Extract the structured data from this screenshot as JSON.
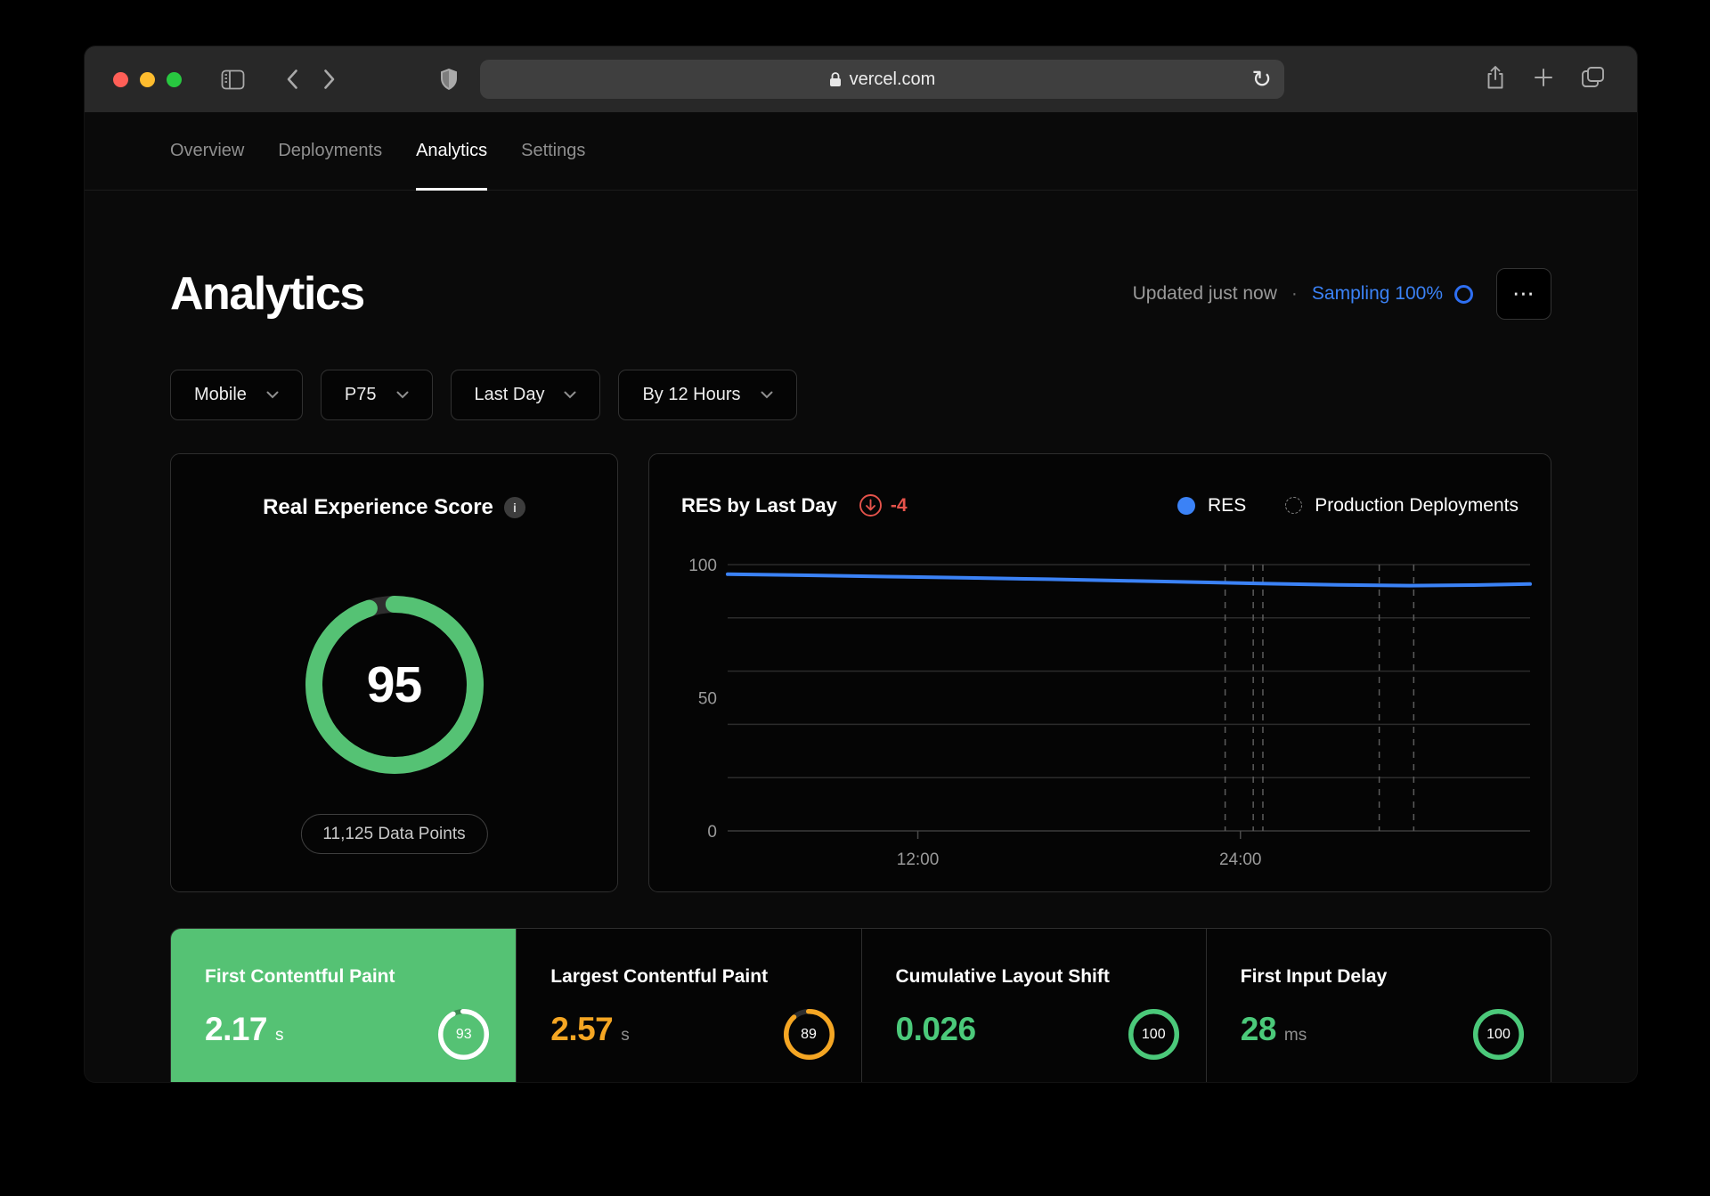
{
  "colors": {
    "blue": "#3b82f6",
    "green": "#55c274",
    "orange": "#f5a623",
    "red": "#e5534b"
  },
  "browser": {
    "url": "vercel.com",
    "icons": [
      "close",
      "minimize",
      "zoom",
      "sidebar-panel",
      "chevron-back",
      "chevron-forward",
      "privacy-shield",
      "lock",
      "reload",
      "share",
      "new-tab-plus",
      "tab-overview"
    ]
  },
  "nav": {
    "tabs": [
      {
        "label": "Overview",
        "active": false
      },
      {
        "label": "Deployments",
        "active": false
      },
      {
        "label": "Analytics",
        "active": true
      },
      {
        "label": "Settings",
        "active": false
      }
    ]
  },
  "header": {
    "title": "Analytics",
    "updated": "Updated just now",
    "separator": "·",
    "sampling": "Sampling 100%",
    "menu_glyph": "⋯"
  },
  "filters": [
    {
      "label": "Mobile"
    },
    {
      "label": "P75"
    },
    {
      "label": "Last Day"
    },
    {
      "label": "By 12 Hours"
    }
  ],
  "res_card": {
    "title": "Real Experience Score",
    "score": 95,
    "data_points": "11,125 Data Points"
  },
  "chart_data": {
    "type": "line",
    "title": "RES by Last Day",
    "delta": "-4",
    "legend": [
      {
        "label": "RES",
        "marker": "filled-dot",
        "color": "#3b82f6"
      },
      {
        "label": "Production Deployments",
        "marker": "dashed-circle",
        "color": "#858585"
      }
    ],
    "ylim": [
      0,
      100
    ],
    "y_gridlines": [
      0,
      20,
      40,
      60,
      80,
      100
    ],
    "y_labels": [
      0,
      50,
      100
    ],
    "x_ticks": [
      {
        "label": "12:00",
        "pos": 0.237
      },
      {
        "label": "24:00",
        "pos": 0.639
      }
    ],
    "series": [
      {
        "name": "RES",
        "color": "#3b82f6",
        "points": [
          [
            0,
            96.4
          ],
          [
            0.1,
            96.0
          ],
          [
            0.2,
            95.5
          ],
          [
            0.3,
            95.0
          ],
          [
            0.4,
            94.5
          ],
          [
            0.5,
            93.9
          ],
          [
            0.6,
            93.3
          ],
          [
            0.68,
            92.8
          ],
          [
            0.76,
            92.4
          ],
          [
            0.85,
            92.1
          ],
          [
            0.93,
            92.3
          ],
          [
            1,
            92.7
          ]
        ]
      }
    ],
    "deployment_lines": [
      0.62,
      0.655,
      0.667,
      0.812,
      0.855
    ],
    "grid": "horizontal",
    "legend_position": "top-right"
  },
  "metrics": [
    {
      "label": "First Contentful Paint",
      "value": "2.17",
      "unit": "s",
      "score": 93,
      "selected": true,
      "value_color": "#ffffff",
      "unit_color": "#ffffff",
      "ring_color": "#ffffff",
      "ring_track": "rgba(0,0,0,0.28)"
    },
    {
      "label": "Largest Contentful Paint",
      "value": "2.57",
      "unit": "s",
      "score": 89,
      "selected": false,
      "value_color": "#f5a623",
      "unit_color": "#8f8f8f",
      "ring_color": "#f5a623",
      "ring_track": "#2e2e2e"
    },
    {
      "label": "Cumulative Layout Shift",
      "value": "0.026",
      "unit": "",
      "score": 100,
      "selected": false,
      "value_color": "#4bc97a",
      "unit_color": "#8f8f8f",
      "ring_color": "#4bc97a",
      "ring_track": "#2e2e2e"
    },
    {
      "label": "First Input Delay",
      "value": "28",
      "unit": "ms",
      "score": 100,
      "selected": false,
      "value_color": "#4bc97a",
      "unit_color": "#8f8f8f",
      "ring_color": "#4bc97a",
      "ring_track": "#2e2e2e"
    }
  ]
}
